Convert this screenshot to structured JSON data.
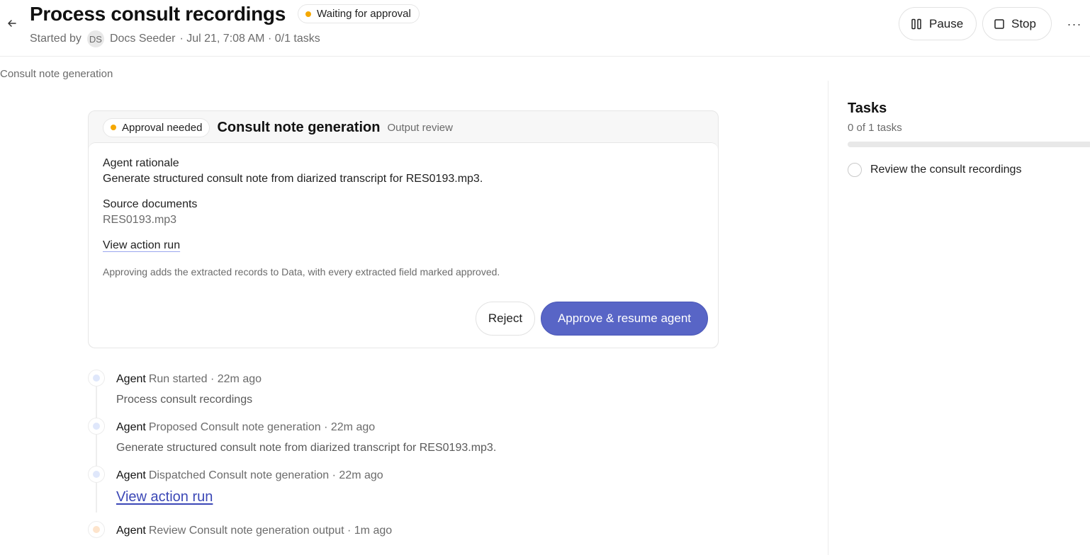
{
  "header": {
    "title": "Process consult recordings",
    "status": "Waiting for approval",
    "started_by_label": "Started by",
    "avatar_initials": "DS",
    "user_name": "Docs Seeder",
    "meta_rest": "· Jul 21, 7:08 AM · 0/1 tasks",
    "pause_label": "Pause",
    "stop_label": "Stop"
  },
  "section_label": "Consult note generation",
  "approval": {
    "badge": "Approval needed",
    "title": "Consult note generation",
    "subtitle": "Output review",
    "rationale_label": "Agent rationale",
    "rationale_text": "Generate structured consult note from diarized transcript for RES0193.mp3.",
    "source_label": "Source documents",
    "source_file": "RES0193.mp3",
    "view_link": "View action run",
    "note": "Approving adds the extracted records to Data, with every extracted field marked approved.",
    "reject_label": "Reject",
    "approve_label": "Approve & resume agent"
  },
  "timeline": [
    {
      "actor": "Agent",
      "text": "Run started · 22m ago",
      "detail": "Process consult recordings",
      "kind": "blue"
    },
    {
      "actor": "Agent",
      "text": "Proposed Consult note generation · 22m ago",
      "detail": "Generate structured consult note from diarized transcript for RES0193.mp3.",
      "kind": "blue"
    },
    {
      "actor": "Agent",
      "text": "Dispatched Consult note generation · 22m ago",
      "link": "View action run",
      "kind": "blue"
    },
    {
      "actor": "Agent",
      "text": "Review Consult note generation output · 1m ago",
      "kind": "orange"
    }
  ],
  "tasks": {
    "title": "Tasks",
    "count": "0 of 1 tasks",
    "progress": 0,
    "items": [
      {
        "label": "Review the consult recordings",
        "done": false
      }
    ]
  },
  "colors": {
    "accent": "#5865c6",
    "status_dot": "#f5a800",
    "link": "#3b47b6"
  }
}
